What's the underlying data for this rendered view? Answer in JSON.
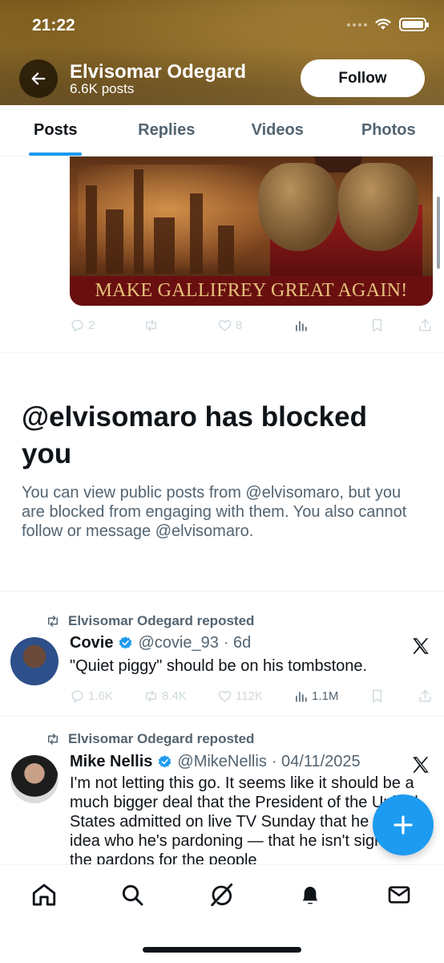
{
  "status_bar": {
    "time": "21:22"
  },
  "header": {
    "name": "Elvisomar Odegard",
    "posts_count": "6.6K posts",
    "follow_label": "Follow"
  },
  "tabs": [
    {
      "label": "Posts",
      "active": true
    },
    {
      "label": "Replies",
      "active": false
    },
    {
      "label": "Videos",
      "active": false
    },
    {
      "label": "Photos",
      "active": false
    }
  ],
  "image_post": {
    "banner_text": "MAKE GALLIFREY GREAT AGAIN!",
    "replies": "2",
    "retweets": "",
    "likes": "8"
  },
  "blocked": {
    "title": "@elvisomaro has blocked you",
    "description": "You can view public posts from @elvisomaro, but you are blocked from engaging with them. You also cannot follow or message @elvisomaro."
  },
  "feed": [
    {
      "repost_label": "Elvisomar Odegard reposted",
      "name": "Covie",
      "handle": "@covie_93",
      "time": "· 6d",
      "text": "\"Quiet piggy\" should be on his tombstone.",
      "replies": "1.6K",
      "retweets": "8.4K",
      "likes": "112K",
      "views": "1.1M"
    },
    {
      "repost_label": "Elvisomar Odegard reposted",
      "name": "Mike Nellis",
      "handle": "@MikeNellis",
      "time": "· 04/11/2025",
      "text": "I'm not letting this go. It seems like it should be a much bigger deal that the President of the United States admitted on live TV Sunday that he has no idea who he's pardoning — that he isn't signing the pardons for the people"
    }
  ],
  "colors": {
    "accent": "#1d9bf0",
    "header_gold": "#8f6c28",
    "text_secondary": "#536471"
  }
}
